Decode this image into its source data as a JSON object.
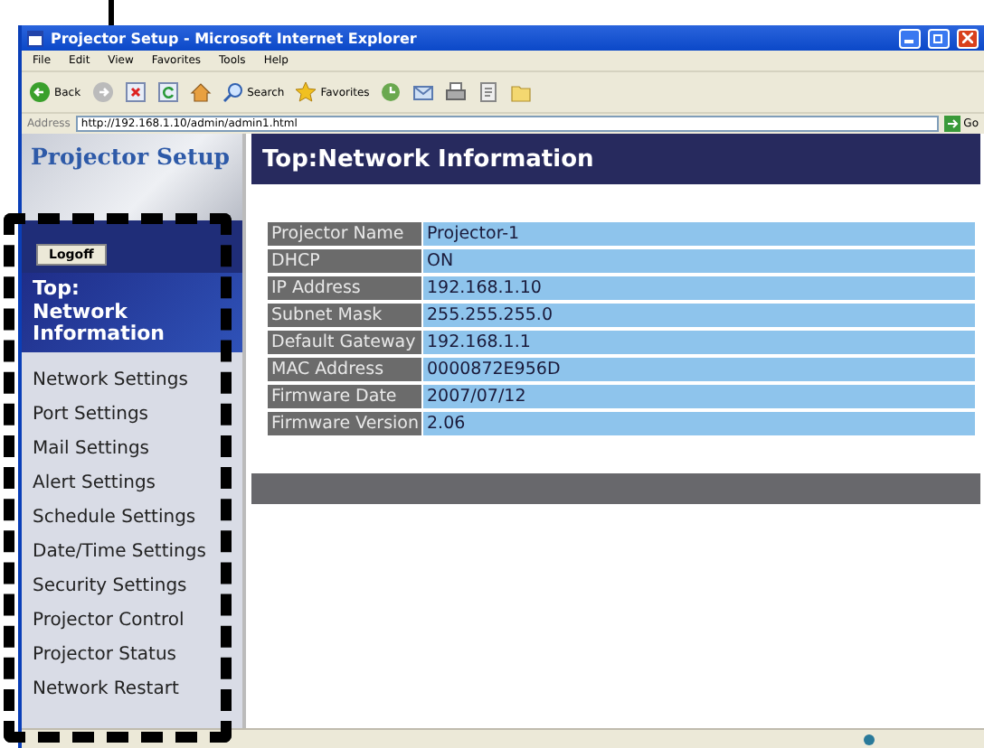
{
  "window": {
    "title": "Projector Setup - Microsoft Internet Explorer",
    "menu": [
      "File",
      "Edit",
      "View",
      "Favorites",
      "Tools",
      "Help"
    ],
    "toolbar": [
      {
        "kind": "back",
        "label": "Back"
      },
      {
        "kind": "forward"
      },
      {
        "kind": "stop"
      },
      {
        "kind": "refresh"
      },
      {
        "kind": "home"
      },
      {
        "kind": "search",
        "label": "Search"
      },
      {
        "kind": "favorites",
        "label": "Favorites"
      },
      {
        "kind": "history"
      },
      {
        "kind": "mail"
      },
      {
        "kind": "print"
      },
      {
        "kind": "edit"
      },
      {
        "kind": "folder"
      }
    ],
    "address": {
      "label": "Address",
      "value": "http://192.168.1.10/admin/admin1.html",
      "go": "Go"
    }
  },
  "sidebar": {
    "logo": "Projector Setup",
    "logoff": "Logoff",
    "items": [
      {
        "label": "Top: Network Information",
        "selected": true
      },
      {
        "label": "Network Settings",
        "selected": false
      },
      {
        "label": "Port Settings",
        "selected": false
      },
      {
        "label": "Mail Settings",
        "selected": false
      },
      {
        "label": "Alert Settings",
        "selected": false
      },
      {
        "label": "Schedule Settings",
        "selected": false
      },
      {
        "label": "Date/Time Settings",
        "selected": false
      },
      {
        "label": "Security Settings",
        "selected": false
      },
      {
        "label": "Projector Control",
        "selected": false
      },
      {
        "label": "Projector Status",
        "selected": false
      },
      {
        "label": "Network Restart",
        "selected": false
      }
    ]
  },
  "content": {
    "heading": "Top:Network Information",
    "rows": [
      {
        "label": "Projector Name",
        "value": "Projector-1"
      },
      {
        "label": "DHCP",
        "value": "ON"
      },
      {
        "label": "IP Address",
        "value": "192.168.1.10"
      },
      {
        "label": "Subnet Mask",
        "value": "255.255.255.0"
      },
      {
        "label": "Default Gateway",
        "value": "192.168.1.1"
      },
      {
        "label": "MAC Address",
        "value": "0000872E956D"
      },
      {
        "label": "Firmware Date",
        "value": "2007/07/12"
      },
      {
        "label": "Firmware Version",
        "value": "2.06"
      }
    ]
  }
}
